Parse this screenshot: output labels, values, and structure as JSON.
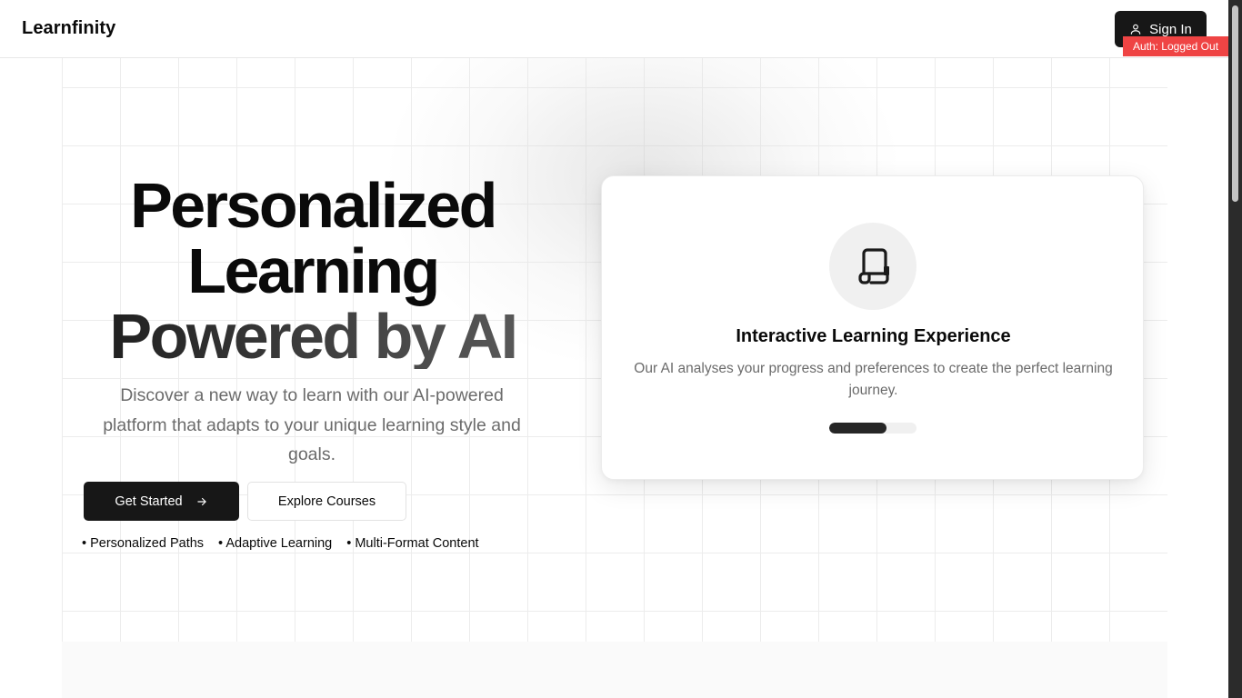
{
  "header": {
    "logo": "Learnfinity",
    "signin_label": "Sign In",
    "auth_badge": "Auth: Logged Out"
  },
  "hero": {
    "headline_line1": "Personalized",
    "headline_line2": "Learning",
    "headline_line3": "Powered by AI",
    "subtext": "Discover a new way to learn with our AI-powered platform that adapts to your unique learning style and goals.",
    "primary_button": "Get Started",
    "secondary_button": "Explore Courses",
    "features": [
      "• Personalized Paths",
      "• Adaptive Learning",
      "• Multi-Format Content"
    ]
  },
  "card": {
    "icon": "scroll-icon",
    "title": "Interactive Learning Experience",
    "description": "Our AI analyses your progress and preferences to create the perfect learning journey.",
    "progress": 0.66
  },
  "colors": {
    "primary": "#171717",
    "badge": "#ef4444",
    "muted_text": "#6b6b6b"
  }
}
